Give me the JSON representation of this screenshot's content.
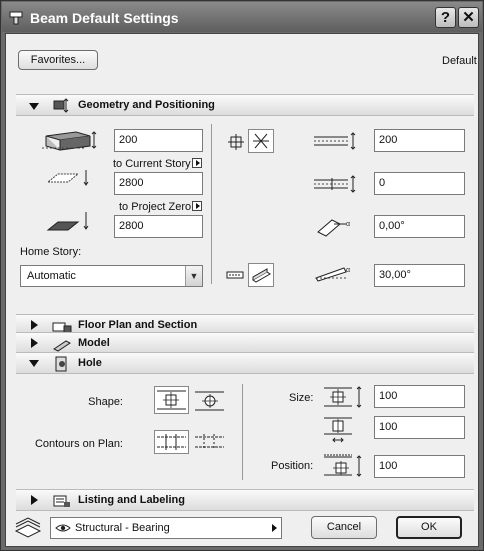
{
  "window": {
    "title": "Beam Default Settings",
    "help_label": "?",
    "close_label": "✕"
  },
  "top": {
    "favorites_label": "Favorites...",
    "default_label": "Default"
  },
  "geometry": {
    "section_title": "Geometry and Positioning",
    "height_value": "200",
    "to_current_story_label": "to Current Story",
    "offset_value": "2800",
    "to_project_zero_label": "to Project Zero",
    "elevation_value": "2800",
    "home_story_label": "Home Story:",
    "home_story_value": "Automatic",
    "width_value": "200",
    "ref_offset_value": "0",
    "slant_angle_value": "0,00°",
    "incline_angle_value": "30,00°"
  },
  "sections": {
    "floor_plan": "Floor Plan and Section",
    "model": "Model",
    "hole": "Hole",
    "listing": "Listing and Labeling"
  },
  "hole": {
    "shape_label": "Shape:",
    "contours_label": "Contours on Plan:",
    "size_label": "Size:",
    "size_value_1": "100",
    "size_value_2": "100",
    "position_label": "Position:",
    "position_value": "100"
  },
  "bottom": {
    "layer_value": "Structural - Bearing",
    "cancel_label": "Cancel",
    "ok_label": "OK"
  }
}
